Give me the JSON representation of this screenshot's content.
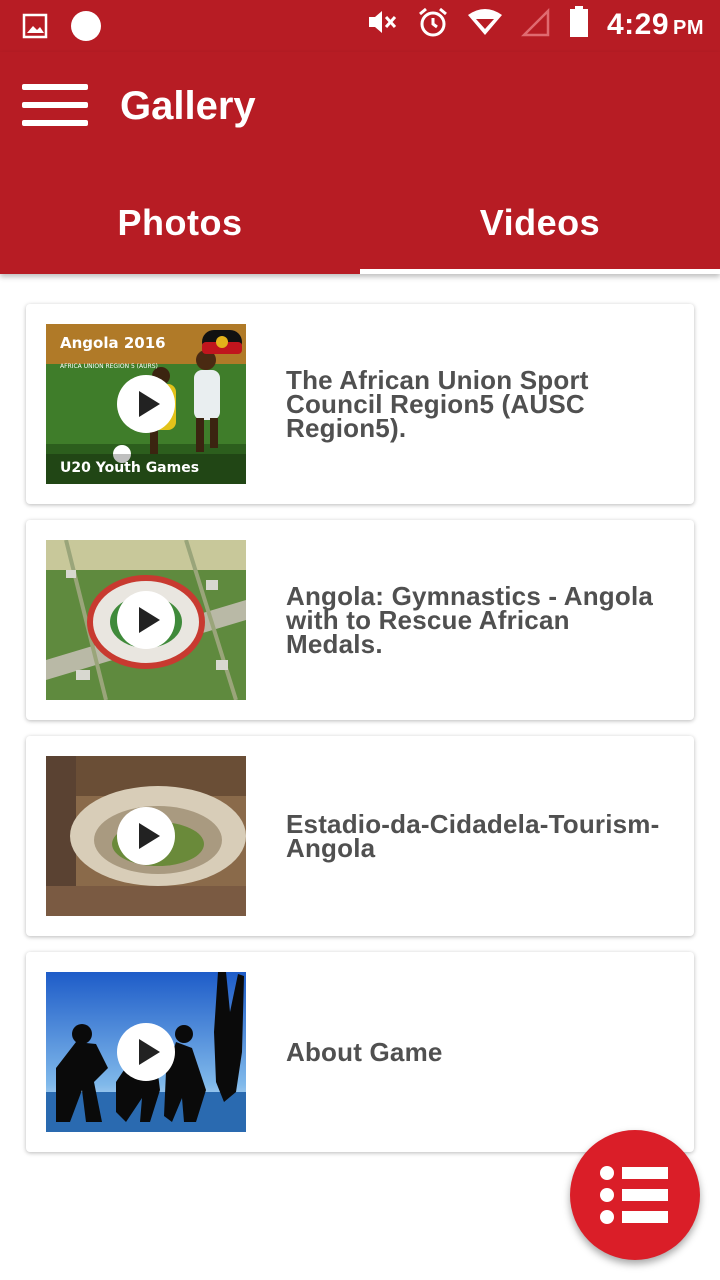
{
  "status_bar": {
    "time": "4:29",
    "ampm": "PM",
    "icons": [
      "image-icon",
      "circle-notification-icon",
      "mute-icon",
      "alarm-icon",
      "wifi-icon",
      "no-signal-icon",
      "battery-icon"
    ]
  },
  "app_bar": {
    "title": "Gallery",
    "menu_icon": "hamburger-icon"
  },
  "tabs": [
    {
      "label": "Photos",
      "selected": false
    },
    {
      "label": "Videos",
      "selected": true
    }
  ],
  "videos": [
    {
      "title": "The African Union Sport Council Region5 (AUSC Region5).",
      "thumb_text_top": "Angola 2016",
      "thumb_text_sub": "AFRICA UNION REGION 5 (AURS)",
      "thumb_text_bottom": "U20 Youth Games"
    },
    {
      "title": "Angola: Gymnastics - Angola with to Rescue African Medals."
    },
    {
      "title": "Estadio-da-Cidadela-Tourism-Angola"
    },
    {
      "title": "About Game"
    }
  ],
  "fab": {
    "icon": "list-icon"
  },
  "colors": {
    "primary": "#b71c24",
    "fab": "#da1e28",
    "title_text": "#505050"
  }
}
